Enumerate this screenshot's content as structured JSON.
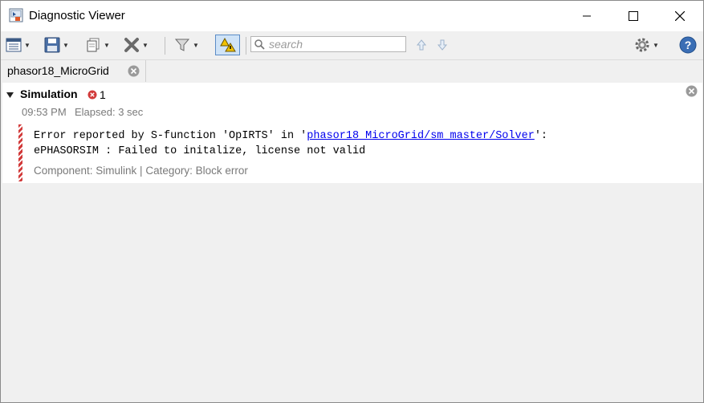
{
  "window": {
    "title": "Diagnostic Viewer",
    "controls": {
      "minimize": "minimize",
      "maximize": "maximize",
      "close": "close"
    }
  },
  "toolbar": {
    "search_placeholder": "search",
    "icons": [
      "view-options-icon",
      "save-icon",
      "copy-icon",
      "clear-icon",
      "filter-icon",
      "warning-toggle-icon",
      "search-icon",
      "up-arrow-icon",
      "down-arrow-icon",
      "settings-icon",
      "help-icon"
    ]
  },
  "tabs": [
    {
      "label": "phasor18_MicroGrid",
      "active": true
    }
  ],
  "diagnostics": {
    "group_title": "Simulation",
    "error_count": "1",
    "time": "09:53 PM",
    "elapsed": "Elapsed: 3 sec",
    "message": {
      "prefix": "Error reported by S-function 'OpIRTS' in '",
      "link": "phasor18_MicroGrid/sm_master/Solver",
      "suffix": "':",
      "line2": "ePHASORSIM : Failed to initalize, license not valid"
    },
    "component_line": "Component: Simulink | Category: Block error"
  },
  "colors": {
    "error_red": "#d23a3a",
    "link_blue": "#0000ee",
    "muted_text": "#7a7a7a"
  }
}
